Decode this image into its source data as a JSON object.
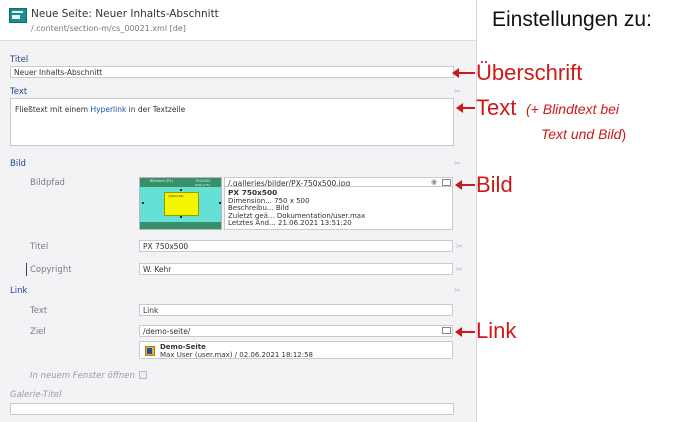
{
  "header": {
    "title": "Neue Seite: Neuer Inhalts-Abschnitt",
    "path": "/.content/section-m/cs_00021.xml [de]"
  },
  "form": {
    "titel_label": "Titel",
    "titel_value": "Neuer Inhalts-Abschnitt",
    "text_label": "Text",
    "text_before": "Fließtext mit einem ",
    "text_link": "Hyperlink",
    "text_after": " in der Textzeile",
    "bild_label": "Bild",
    "bildpfad_label": "Bildpfad",
    "bildpfad_value": "/.galleries/bilder/PX-750x500.jpg",
    "thumb_texts": [
      "Bildrand (PX)",
      "750x500",
      "(PX0-275)",
      "(160x106)"
    ],
    "image_info": {
      "name": "PX 750x500",
      "rows": [
        [
          "Dimension...",
          "750 x 500"
        ],
        [
          "Beschreibu...",
          "Bild"
        ],
        [
          "Zuletzt geä...",
          "Dokumentation/user.max"
        ],
        [
          "Letztes Änd...",
          "21.06.2021 13:51:20"
        ]
      ]
    },
    "bild_titel_label": "Titel",
    "bild_titel_value": "PX 750x500",
    "copyright_label": "Copyright",
    "copyright_value": "W. Kehr",
    "link_label": "Link",
    "link_text_label": "Text",
    "link_text_value": "Link",
    "ziel_label": "Ziel",
    "ziel_value": "/demo-seite/",
    "target_info": {
      "name": "Demo-Seite",
      "details": "Max User (user.max) / 02.06.2021 18:12:58"
    },
    "new_window_label": "In neuem Fenster öffnen",
    "galerie_label": "Galerie-Titel"
  },
  "annotations": {
    "title": "Einstellungen zu:",
    "ueberschrift": "Überschrift",
    "text": "Text",
    "text_note_line1": "(+ Blindtext bei",
    "text_note_line2": "Text und Bild",
    "text_note_paren": ")",
    "bild": "Bild",
    "link": "Link",
    "accent_color": "#cc1a1a"
  }
}
